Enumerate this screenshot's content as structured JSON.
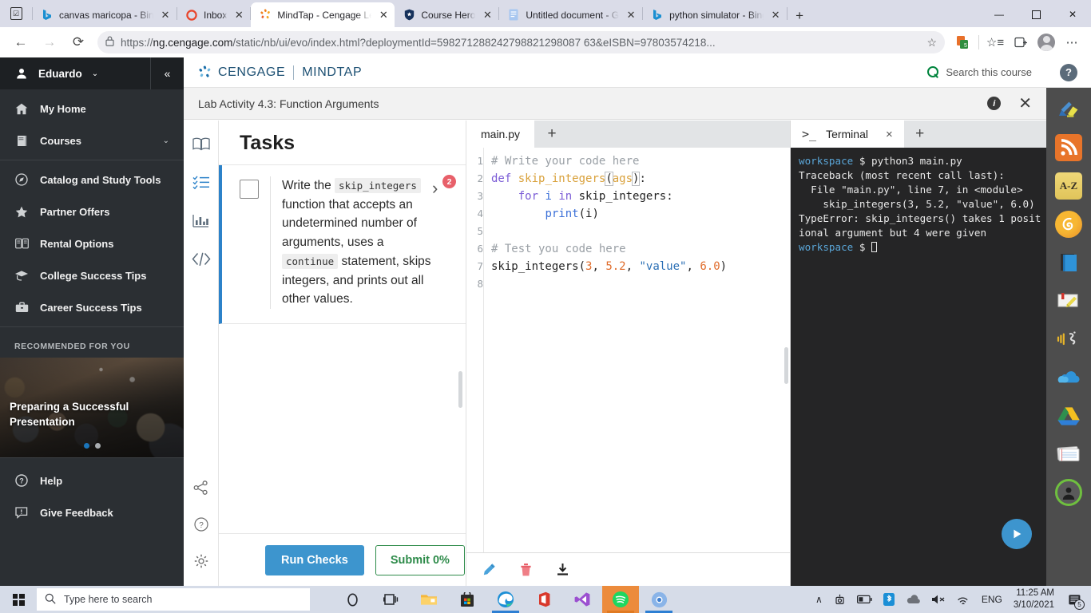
{
  "browser": {
    "tabs": [
      {
        "title": "canvas maricopa - Bing",
        "icon": "bing-icon",
        "active": false
      },
      {
        "title": "Inbox",
        "icon": "outlook-icon",
        "active": false
      },
      {
        "title": "MindTap - Cengage Le",
        "icon": "cengage-icon",
        "active": true
      },
      {
        "title": "Course Hero",
        "icon": "coursehero-icon",
        "active": false
      },
      {
        "title": "Untitled document - G",
        "icon": "googledocs-icon",
        "active": false
      },
      {
        "title": "python simulator - Bing",
        "icon": "bing-icon",
        "active": false
      }
    ],
    "new_tab_label": "+",
    "window_controls": {
      "minimize": "—",
      "maximize": "❐",
      "close": "✕"
    },
    "nav": {
      "back": "←",
      "forward": "→",
      "reload": "⟳"
    },
    "url": {
      "lock_icon": "lock-icon",
      "prefix": "https://",
      "domain": "ng.cengage.com",
      "path": "/static/nb/ui/evo/index.html?deploymentId=598271288242798821298087 63&eISBN=97803574218...",
      "full": "https://ng.cengage.com/static/nb/ui/evo/index.html?deploymentId=5982712882427988212 9808763&eISBN=97803574218..."
    },
    "toolbar_icons": [
      "favorite-star-icon",
      "extension-icon",
      "collections-icon",
      "add-collection-icon",
      "profile-avatar",
      "settings-more-icon"
    ]
  },
  "sidebar": {
    "user": {
      "name": "Eduardo",
      "icon": "person-icon",
      "chevron": "⌄"
    },
    "collapse_icon": "«",
    "items": [
      {
        "label": "My Home",
        "icon": "home-icon",
        "chevron": ""
      },
      {
        "label": "Courses",
        "icon": "book-icon",
        "chevron": "⌄"
      },
      {
        "label": "Catalog and Study Tools",
        "icon": "compass-icon",
        "chevron": ""
      },
      {
        "label": "Partner Offers",
        "icon": "star-icon",
        "chevron": ""
      },
      {
        "label": "Rental Options",
        "icon": "open-book-icon",
        "chevron": ""
      },
      {
        "label": "College Success Tips",
        "icon": "graduation-cap-icon",
        "chevron": ""
      },
      {
        "label": "Career Success Tips",
        "icon": "briefcase-icon",
        "chevron": ""
      }
    ],
    "recommended_header": "RECOMMENDED FOR YOU",
    "card": {
      "title": "Preparing a Successful Presentation",
      "dots": 2,
      "active_dot": 0
    },
    "bottom_items": [
      {
        "label": "Help",
        "icon": "question-circle-icon"
      },
      {
        "label": "Give Feedback",
        "icon": "feedback-icon"
      }
    ]
  },
  "mindtap": {
    "brand_cengage": "CENGAGE",
    "brand_mindtap": "MINDTAP",
    "search_label": "Search this course",
    "search_icon": "search-icon",
    "activity_title": "Lab Activity 4.3: Function Arguments",
    "info_icon": "i",
    "close_icon": "✕"
  },
  "rail": {
    "items": [
      {
        "icon": "book-reader-icon",
        "selected": false
      },
      {
        "icon": "checklist-icon",
        "selected": true
      },
      {
        "icon": "bar-chart-icon",
        "selected": false
      },
      {
        "icon": "code-brackets-icon",
        "selected": false
      }
    ],
    "bottom_items": [
      {
        "icon": "share-icon"
      },
      {
        "icon": "help-circle-icon"
      },
      {
        "icon": "gear-icon"
      }
    ]
  },
  "tasks": {
    "heading": "Tasks",
    "items": [
      {
        "checked": false,
        "badge": "2",
        "chevron": "›",
        "parts": [
          {
            "type": "text",
            "value": "Write the "
          },
          {
            "type": "code",
            "value": "skip_integers"
          },
          {
            "type": "text",
            "value": " function that accepts an undetermined number of arguments, uses a "
          },
          {
            "type": "code",
            "value": "continue"
          },
          {
            "type": "text",
            "value": " statement, skips integers, and prints out all other values."
          }
        ]
      }
    ],
    "run_checks_label": "Run Checks",
    "submit_label": "Submit 0%"
  },
  "editor": {
    "tab_label": "main.py",
    "new_tab": "+",
    "line_numbers": [
      "1",
      "2",
      "3",
      "4",
      "5",
      "6",
      "7",
      "8"
    ],
    "lines": [
      [
        {
          "t": "cm",
          "v": "# Write your code here"
        }
      ],
      [
        {
          "t": "kw",
          "v": "def"
        },
        {
          "t": "plain",
          "v": " "
        },
        {
          "t": "fn",
          "v": "skip_integers"
        },
        {
          "t": "hl",
          "v": "("
        },
        {
          "t": "fn",
          "v": "ags"
        },
        {
          "t": "hl",
          "v": ")"
        },
        {
          "t": "plain",
          "v": ":"
        }
      ],
      [
        {
          "t": "plain",
          "v": "    "
        },
        {
          "t": "kw",
          "v": "for"
        },
        {
          "t": "plain",
          "v": " "
        },
        {
          "t": "blue",
          "v": "i"
        },
        {
          "t": "plain",
          "v": " "
        },
        {
          "t": "kw",
          "v": "in"
        },
        {
          "t": "plain",
          "v": " skip_integers:"
        }
      ],
      [
        {
          "t": "plain",
          "v": "        "
        },
        {
          "t": "blue",
          "v": "print"
        },
        {
          "t": "plain",
          "v": "(i)"
        }
      ],
      [
        {
          "t": "plain",
          "v": ""
        }
      ],
      [
        {
          "t": "cm",
          "v": "# Test you code here"
        }
      ],
      [
        {
          "t": "plain",
          "v": "skip_integers("
        },
        {
          "t": "num",
          "v": "3"
        },
        {
          "t": "plain",
          "v": ", "
        },
        {
          "t": "num",
          "v": "5.2"
        },
        {
          "t": "plain",
          "v": ", "
        },
        {
          "t": "str",
          "v": "\"value\""
        },
        {
          "t": "plain",
          "v": ", "
        },
        {
          "t": "num",
          "v": "6.0"
        },
        {
          "t": "plain",
          "v": ")"
        }
      ],
      [
        {
          "t": "plain",
          "v": ""
        }
      ]
    ],
    "footer_icons": [
      "pencil-edit-icon",
      "trash-delete-icon",
      "download-icon"
    ]
  },
  "terminal": {
    "tab_label": "Terminal",
    "tab_icon": ">_",
    "close_icon": "×",
    "new_tab": "+",
    "output": [
      {
        "type": "prompt",
        "host": "workspace",
        "sym": "$",
        "cmd": " python3 main.py"
      },
      {
        "type": "line",
        "value": "Traceback (most recent call last):"
      },
      {
        "type": "line",
        "value": "  File \"main.py\", line 7, in <module>"
      },
      {
        "type": "line",
        "value": "    skip_integers(3, 5.2, \"value\", 6.0)"
      },
      {
        "type": "line",
        "value": "TypeError: skip_integers() takes 1 positional argument but 4 were given"
      },
      {
        "type": "prompt",
        "host": "workspace",
        "sym": "$",
        "cmd": "",
        "caret": true
      }
    ],
    "run_button_icon": "play-icon"
  },
  "app_rail": {
    "help_icon": "?",
    "items": [
      {
        "icon": "highlighter-pen-icon"
      },
      {
        "icon": "rss-feed-icon"
      },
      {
        "icon": "az-dictionary-icon"
      },
      {
        "icon": "brand-swirl-icon"
      },
      {
        "icon": "blue-book-icon"
      },
      {
        "icon": "notebook-marker-icon"
      },
      {
        "icon": "read-aloud-icon"
      },
      {
        "icon": "onedrive-cloud-icon"
      },
      {
        "icon": "google-drive-icon"
      },
      {
        "icon": "flashcards-icon"
      },
      {
        "icon": "profile-ring-icon"
      }
    ]
  },
  "taskbar": {
    "start_icon": "windows-logo",
    "search_placeholder": "Type here to search",
    "search_icon": "search-icon",
    "apps": [
      {
        "icon": "cortana-icon"
      },
      {
        "icon": "task-view-icon"
      },
      {
        "icon": "file-explorer-icon"
      },
      {
        "icon": "microsoft-store-icon"
      },
      {
        "icon": "edge-browser-icon"
      },
      {
        "icon": "office-icon"
      },
      {
        "icon": "visual-studio-icon"
      },
      {
        "icon": "spotify-icon"
      },
      {
        "icon": "chrome-icon"
      }
    ],
    "tray": {
      "chevron": "∧",
      "icons": [
        "camera-icon",
        "battery-icon",
        "bluetooth-icon",
        "onedrive-icon",
        "volume-muted-icon",
        "wifi-icon"
      ],
      "language": "ENG",
      "time": "11:25 AM",
      "date": "3/10/2021",
      "notification_count": "5"
    }
  },
  "colors": {
    "accent_blue": "#3d95ce",
    "submit_green": "#2e8b4a",
    "badge_red": "#e8606a",
    "sidebar_dark": "#2b2f33",
    "terminal_bg": "#252526",
    "cengage_navy": "#1b4f72"
  }
}
